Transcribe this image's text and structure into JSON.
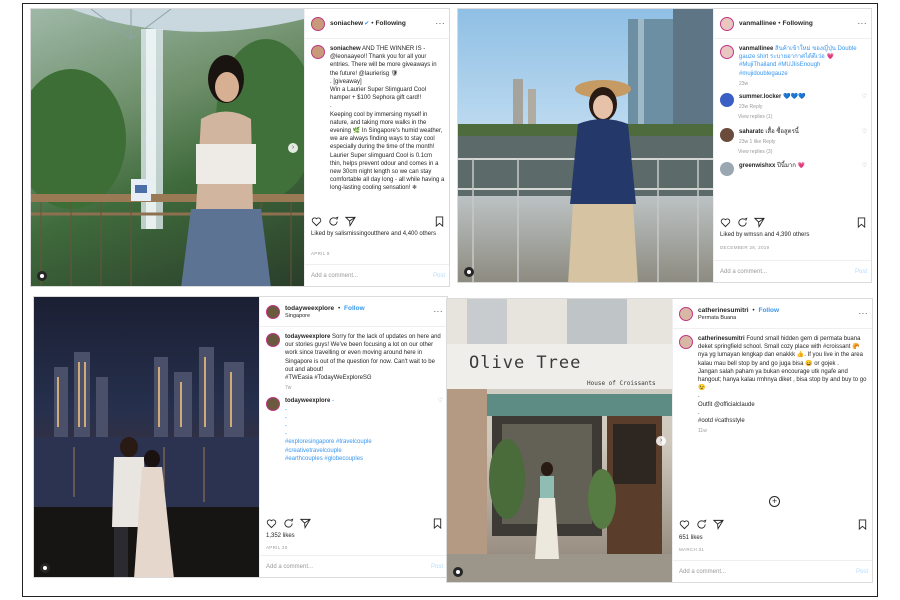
{
  "posts": [
    {
      "username": "soniachew",
      "follow": "Following",
      "caption_user": "soniachew",
      "caption": "AND THE WINNER IS - @leonaayeo!! Thank you for all your entries. There will be more giveaways in the future! @laurierisg 🛡\n. [giveaway]\nWin a Laurier Super Slimguard Cool hamper + $100 Sephora gift card!!\n.\nKeeping cool by immersing myself in nature, and taking more walks in the evening 🌿 In Singapore's humid weather, we are always finding ways to stay cool especially during the time of the month! Laurier Super slimguard Cool is 0.1cm thin, helps prevent odour and comes in a new 30cm night length so we can stay comfortable all day long - all while having a long-lasting cooling sensation! ❄",
      "liked_by": "Liked by salismissingoutthere and 4,400 others",
      "date": "April 8",
      "add_comment": "Add a comment...",
      "post": "Post"
    },
    {
      "username": "vanmallinee",
      "follow": "Following",
      "caption_user": "vanmallinee",
      "caption": "สินค้าเข้าใหม่ ของญี่ปุ่น Double gauze shirt ระบายอากาศได้ดีเว่อ 💗 #MujiThailand #MUJIisEnough #mujidoublegauze",
      "caption_time": "23w",
      "comments": [
        {
          "user": "summer.locker",
          "text": "💙💙💙",
          "meta": "23w  Reply",
          "replies": "View replies (1)"
        },
        {
          "user": "saharatc",
          "text": "เสื้อ ซื้อสูตรนี้",
          "meta": "23w  1 like  Reply",
          "replies": "View replies (3)"
        },
        {
          "user": "greenwishxx",
          "text": "ปีนี้มาก 💗",
          "meta": "",
          "replies": ""
        }
      ],
      "liked_by": "Liked by wmssn and 4,390 others",
      "date": "December 28, 2019",
      "add_comment": "Add a comment...",
      "post": "Post"
    },
    {
      "username": "todayweexplore",
      "follow": "Follow",
      "location": "Singapore",
      "caption_user": "todayweexplore",
      "caption": "Sorry for the lack of updates on here and our stories guys! We've been focusing a lot on our other work since travelling or even moving around here in Singapore is out of the question for now. Can't wait to be out and about!\n#TWEasia #TodayWeExploreSG",
      "caption_time": "7w",
      "comment_user": "todayweexplore",
      "comment_text": "-\n-\n-\n-\n-\n#exploresingapore #travelcouple\n#creativetravelcouple\n#earthcouples #globecouples",
      "likes": "1,352 likes",
      "date": "April 20",
      "add_comment": "Add a comment...",
      "post": "Post"
    },
    {
      "username": "catherinesumitri",
      "follow": "Follow",
      "location": "Permata Buana",
      "caption_user": "catherinesumitri",
      "caption": "Found small hidden gem di permata buana deket springfield school. Small cozy place with #croissant 🥐 nya yg lumayan lengkap dan enakkk 👍. If you live in the area kalau mau bell stop by and go juga bisa 😄 or gojek .\nJangan salah paham ya bukan encourage utk ngafe and hangout; hanya kalau rmhnya diket , bisa stop by and buy to go 😉\n.\nOutfit @officialclaude\n.\n#ootd #cathsstyle",
      "caption_time": "11w",
      "likes": "651 likes",
      "date": "March 31",
      "add_comment": "Add a comment...",
      "post": "Post",
      "shop_sign": "Olive Tree",
      "shop_sub": "House of Croissants"
    }
  ]
}
